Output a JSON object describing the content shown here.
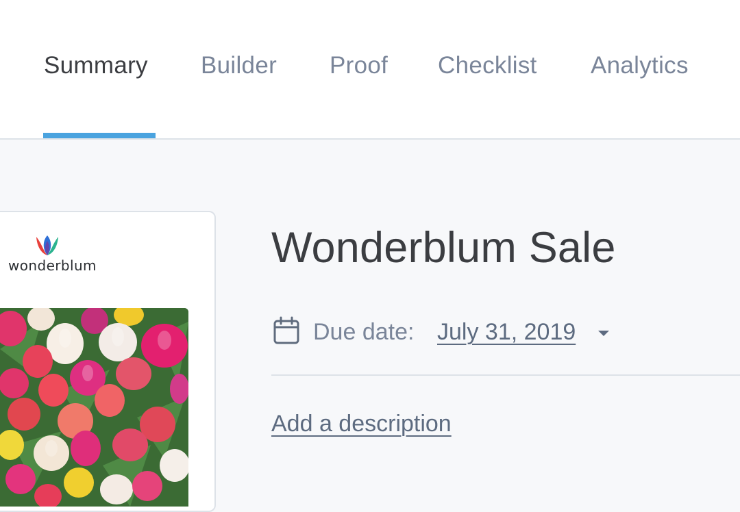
{
  "tabs": [
    {
      "label": "Summary",
      "active": true
    },
    {
      "label": "Builder",
      "active": false
    },
    {
      "label": "Proof",
      "active": false
    },
    {
      "label": "Checklist",
      "active": false
    },
    {
      "label": "Analytics",
      "active": false
    }
  ],
  "colors": {
    "active_tab_indicator": "#4aa3df",
    "text_primary": "#3b3d41",
    "text_muted": "#7a8599",
    "link": "#5d6b80"
  },
  "preview": {
    "brand_name": "wonderblum",
    "logo_icon": "tulip-logo-icon",
    "image": "tulip-bouquet-photo"
  },
  "campaign": {
    "title": "Wonderblum Sale",
    "due_label": "Due date:",
    "due_value": "July 31, 2019",
    "add_description": "Add a description"
  }
}
